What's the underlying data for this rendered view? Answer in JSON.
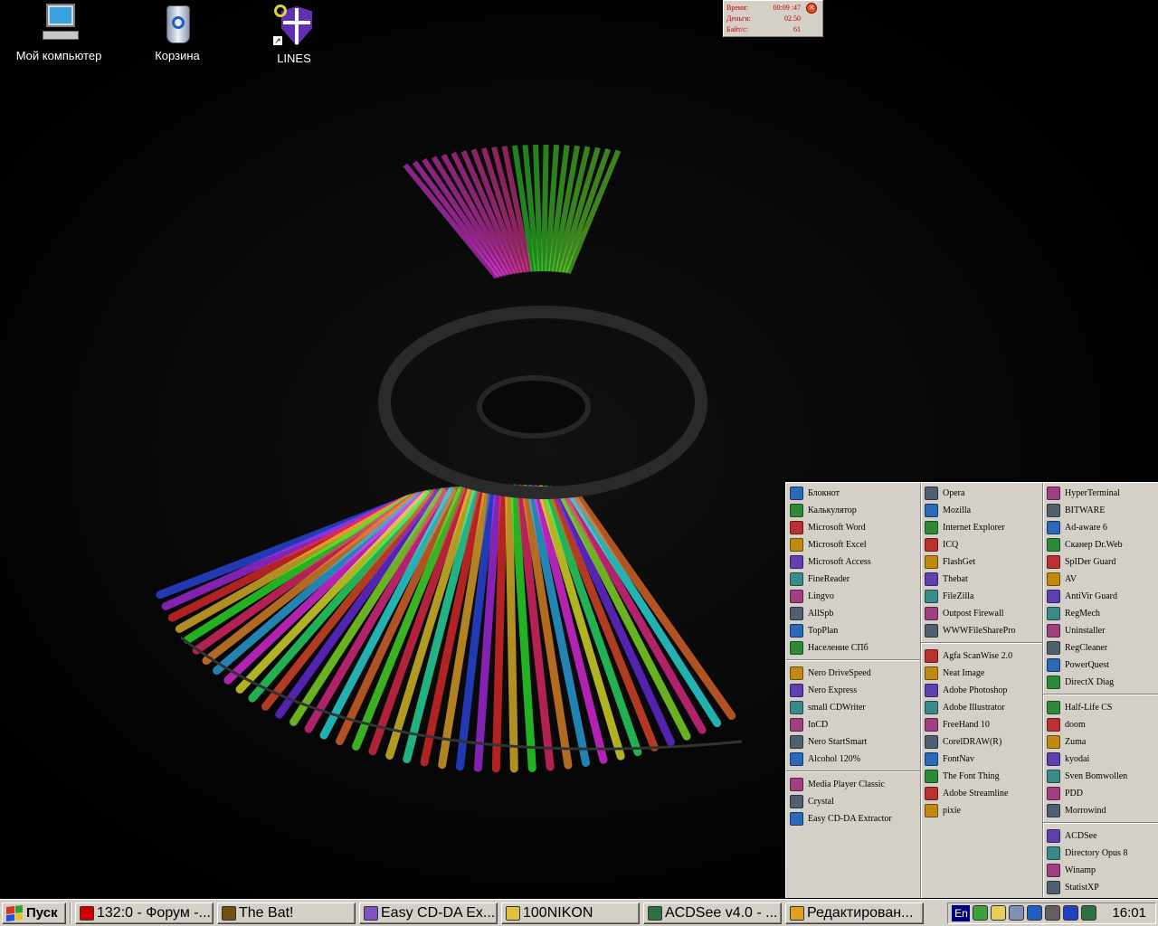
{
  "desktop": {
    "icons": [
      {
        "label": "Мой компьютер"
      },
      {
        "label": "Корзина"
      },
      {
        "label": "LINES"
      }
    ]
  },
  "net_monitor": {
    "time_label": "Время:",
    "time_value": "00:09 :47",
    "money_label": "Деньги:",
    "money_value": "02.50",
    "rate_label": "Байт/с:",
    "rate_value": "61"
  },
  "launcher": {
    "columns": [
      [
        [
          "Блокнот",
          "Калькулятор",
          "Microsoft Word",
          "Microsoft Excel",
          "Microsoft Access",
          "FineReader",
          "Lingvo",
          "AllSpb",
          "TopPlan",
          "Население СПб"
        ],
        [
          "Nero DriveSpeed",
          "Nero Express",
          "small CDWriter",
          "InCD",
          "Nero StartSmart",
          "Alcohol 120%"
        ],
        [
          "Media Player Classic",
          "Crystal",
          "Easy CD-DA Extractor"
        ]
      ],
      [
        [
          "Opera",
          "Mozilla",
          "Internet Explorer",
          "ICQ",
          "FlashGet",
          "Thebat",
          "FileZilla",
          "Outpost Firewall",
          "WWWFileSharePro"
        ],
        [
          "Agfa ScanWise 2.0",
          "Neat Image",
          "Adobe Photoshop",
          "Adobe Illustrator",
          "FreeHand 10",
          "CorelDRAW(R)",
          "FontNav",
          "The Font Thing",
          "Adobe Streamline",
          "pixie"
        ]
      ],
      [
        [
          "HyperTerminal",
          "BITWARE",
          "Ad-aware 6",
          "Сканер Dr.Web",
          "SpIDer Guard",
          "AV",
          "AntiVir Guard",
          "RegMech",
          "Uninstaller",
          "RegCleaner",
          "PowerQuest",
          "DirectX Diag"
        ],
        [
          "Half-Life CS",
          "doom",
          "Zuma",
          "kyodai",
          "Sven Bomwollen",
          "PDD",
          "Morrowind"
        ],
        [
          "ACDSee",
          "Directory Opus 8",
          "Winamp",
          "StatistXP"
        ]
      ]
    ]
  },
  "taskbar": {
    "start_label": "Пуск",
    "tasks": [
      {
        "label": "132:0 - Форум -...",
        "icon": "opera-icon",
        "color": "#cc0000"
      },
      {
        "label": "The Bat!",
        "icon": "bat-icon",
        "color": "#705010"
      },
      {
        "label": "Easy CD-DA Ex...",
        "icon": "cd-icon",
        "color": "#8050c0"
      },
      {
        "label": "100NIKON",
        "icon": "folder-search-icon",
        "color": "#e0c040"
      },
      {
        "label": "ACDSee v4.0 - ...",
        "icon": "acdsee-icon",
        "color": "#307040"
      },
      {
        "label": "Редактирован...",
        "icon": "edit-icon",
        "color": "#e0a020"
      }
    ],
    "lang": "En",
    "clock": "16:01",
    "tray_icons": [
      {
        "icon": "network-icon",
        "color": "#40a040"
      },
      {
        "icon": "speaker-icon",
        "color": "#e0d060"
      },
      {
        "icon": "monitor-icon",
        "color": "#8090b0"
      },
      {
        "icon": "globe-icon",
        "color": "#2060c0"
      },
      {
        "icon": "computer-icon",
        "color": "#606060"
      },
      {
        "icon": "help-icon",
        "color": "#2040c0"
      },
      {
        "icon": "acdsee-tray-icon",
        "color": "#307040"
      }
    ]
  }
}
